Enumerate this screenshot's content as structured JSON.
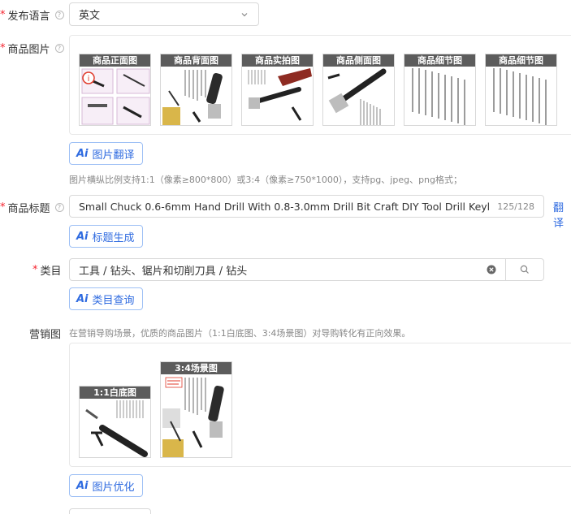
{
  "publish_language": {
    "label": "发布语言",
    "value": "英文"
  },
  "product_images": {
    "label": "商品图片",
    "thumbs": [
      "商品正面图",
      "商品背面图",
      "商品实拍图",
      "商品侧面图",
      "商品细节图",
      "商品细节图"
    ],
    "translate_button": "图片翻译",
    "hint": "图片横纵比例支持1:1（像素≥800*800）或3:4（像素≥750*1000），支持pg、jpeg、png格式；"
  },
  "product_title": {
    "label": "商品标题",
    "value": "Small Chuck 0.6-6mm Hand Drill With 0.8-3.0mm Drill Bit Craft DIY Tool Drill Keyless Chuck",
    "counter": "125/128",
    "translate_link": "翻译",
    "generate_button": "标题生成"
  },
  "category": {
    "label": "类目",
    "value": "工具 / 钻头、锯片和切削刀具 / 钻头",
    "query_button": "类目查询"
  },
  "marketing": {
    "label": "营销图",
    "hint": "在营销导购场景，优质的商品图片（1:1白底图、3:4场景图）对导购转化有正向效果。",
    "thumbs": [
      "1:1白底图",
      "3:4场景图"
    ],
    "optimize_button": "图片优化"
  },
  "icons": {
    "help": "?",
    "ai": "Ai",
    "chevron": "chevron-down-icon",
    "clear": "clear-icon",
    "search": "search-icon"
  }
}
